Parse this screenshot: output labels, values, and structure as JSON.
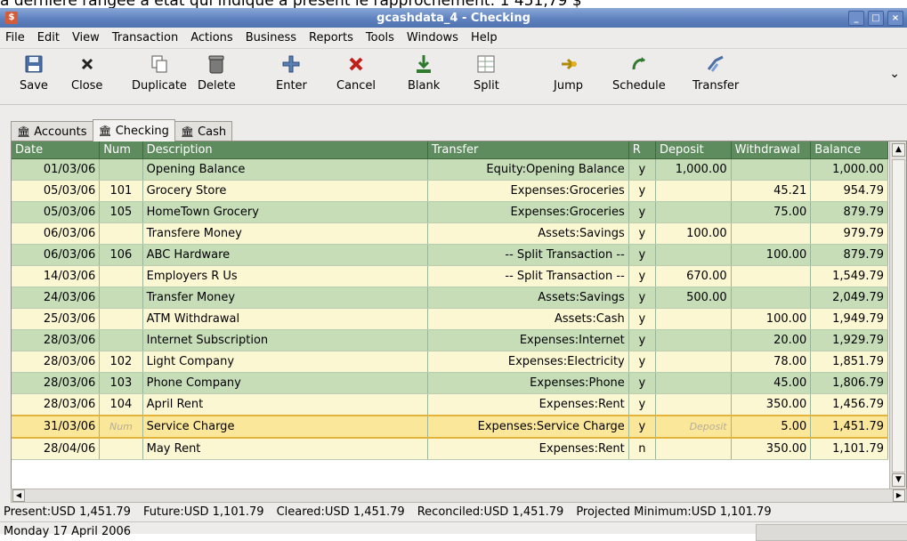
{
  "caption": "a dernière rangée à état qui indique à présent le rapprochement: 1 451,79 $",
  "window": {
    "title": "gcashdata_4 - Checking",
    "controls": [
      "_",
      "□",
      "×"
    ]
  },
  "menu": [
    "File",
    "Edit",
    "View",
    "Transaction",
    "Actions",
    "Business",
    "Reports",
    "Tools",
    "Windows",
    "Help"
  ],
  "toolbar": {
    "save": "Save",
    "close": "Close",
    "duplicate": "Duplicate",
    "delete": "Delete",
    "enter": "Enter",
    "cancel": "Cancel",
    "blank": "Blank",
    "split": "Split",
    "jump": "Jump",
    "schedule": "Schedule",
    "transfer": "Transfer",
    "more": "⌄"
  },
  "tabs": [
    "Accounts",
    "Checking",
    "Cash"
  ],
  "columns": [
    "Date",
    "Num",
    "Description",
    "Transfer",
    "R",
    "Deposit",
    "Withdrawal",
    "Balance"
  ],
  "rows": [
    {
      "date": "01/03/06",
      "num": "",
      "desc": "Opening Balance",
      "transfer": "Equity:Opening Balance",
      "r": "y",
      "deposit": "1,000.00",
      "withdrawal": "",
      "balance": "1,000.00"
    },
    {
      "date": "05/03/06",
      "num": "101",
      "desc": "Grocery Store",
      "transfer": "Expenses:Groceries",
      "r": "y",
      "deposit": "",
      "withdrawal": "45.21",
      "balance": "954.79"
    },
    {
      "date": "05/03/06",
      "num": "105",
      "desc": "HomeTown Grocery",
      "transfer": "Expenses:Groceries",
      "r": "y",
      "deposit": "",
      "withdrawal": "75.00",
      "balance": "879.79"
    },
    {
      "date": "06/03/06",
      "num": "",
      "desc": "Transfere Money",
      "transfer": "Assets:Savings",
      "r": "y",
      "deposit": "100.00",
      "withdrawal": "",
      "balance": "979.79"
    },
    {
      "date": "06/03/06",
      "num": "106",
      "desc": "ABC Hardware",
      "transfer": "-- Split Transaction --",
      "r": "y",
      "deposit": "",
      "withdrawal": "100.00",
      "balance": "879.79"
    },
    {
      "date": "14/03/06",
      "num": "",
      "desc": "Employers R Us",
      "transfer": "-- Split Transaction --",
      "r": "y",
      "deposit": "670.00",
      "withdrawal": "",
      "balance": "1,549.79"
    },
    {
      "date": "24/03/06",
      "num": "",
      "desc": "Transfer Money",
      "transfer": "Assets:Savings",
      "r": "y",
      "deposit": "500.00",
      "withdrawal": "",
      "balance": "2,049.79"
    },
    {
      "date": "25/03/06",
      "num": "",
      "desc": "ATM Withdrawal",
      "transfer": "Assets:Cash",
      "r": "y",
      "deposit": "",
      "withdrawal": "100.00",
      "balance": "1,949.79"
    },
    {
      "date": "28/03/06",
      "num": "",
      "desc": "Internet Subscription",
      "transfer": "Expenses:Internet",
      "r": "y",
      "deposit": "",
      "withdrawal": "20.00",
      "balance": "1,929.79"
    },
    {
      "date": "28/03/06",
      "num": "102",
      "desc": "Light Company",
      "transfer": "Expenses:Electricity",
      "r": "y",
      "deposit": "",
      "withdrawal": "78.00",
      "balance": "1,851.79"
    },
    {
      "date": "28/03/06",
      "num": "103",
      "desc": "Phone Company",
      "transfer": "Expenses:Phone",
      "r": "y",
      "deposit": "",
      "withdrawal": "45.00",
      "balance": "1,806.79"
    },
    {
      "date": "28/03/06",
      "num": "104",
      "desc": "April Rent",
      "transfer": "Expenses:Rent",
      "r": "y",
      "deposit": "",
      "withdrawal": "350.00",
      "balance": "1,456.79"
    },
    {
      "date": "31/03/06",
      "num": "Num",
      "desc": "Service Charge",
      "transfer": "Expenses:Service Charge",
      "r": "y",
      "deposit": "Deposit",
      "withdrawal": "5.00",
      "balance": "1,451.79"
    },
    {
      "date": "28/04/06",
      "num": "",
      "desc": "May Rent",
      "transfer": "Expenses:Rent",
      "r": "n",
      "deposit": "",
      "withdrawal": "350.00",
      "balance": "1,101.79"
    }
  ],
  "summary": {
    "present": "Present:USD 1,451.79",
    "future": "Future:USD 1,101.79",
    "cleared": "Cleared:USD 1,451.79",
    "reconciled": "Reconciled:USD 1,451.79",
    "projected": "Projected Minimum:USD 1,101.79"
  },
  "status": "Monday 17 April 2006",
  "colors": {
    "header_green": "#5f8c5f",
    "row_green": "#c6ddb8",
    "row_yellow": "#fcf7d3",
    "cursor_row": "#fbe79a",
    "titlebar_blue": "#5f82bf"
  },
  "cursor_row_index": 12,
  "row_styles": [
    "green",
    "yellow",
    "green",
    "yellow",
    "green",
    "yellow",
    "green",
    "yellow",
    "green",
    "yellow",
    "green",
    "yellow",
    "cursor",
    "yellow"
  ]
}
